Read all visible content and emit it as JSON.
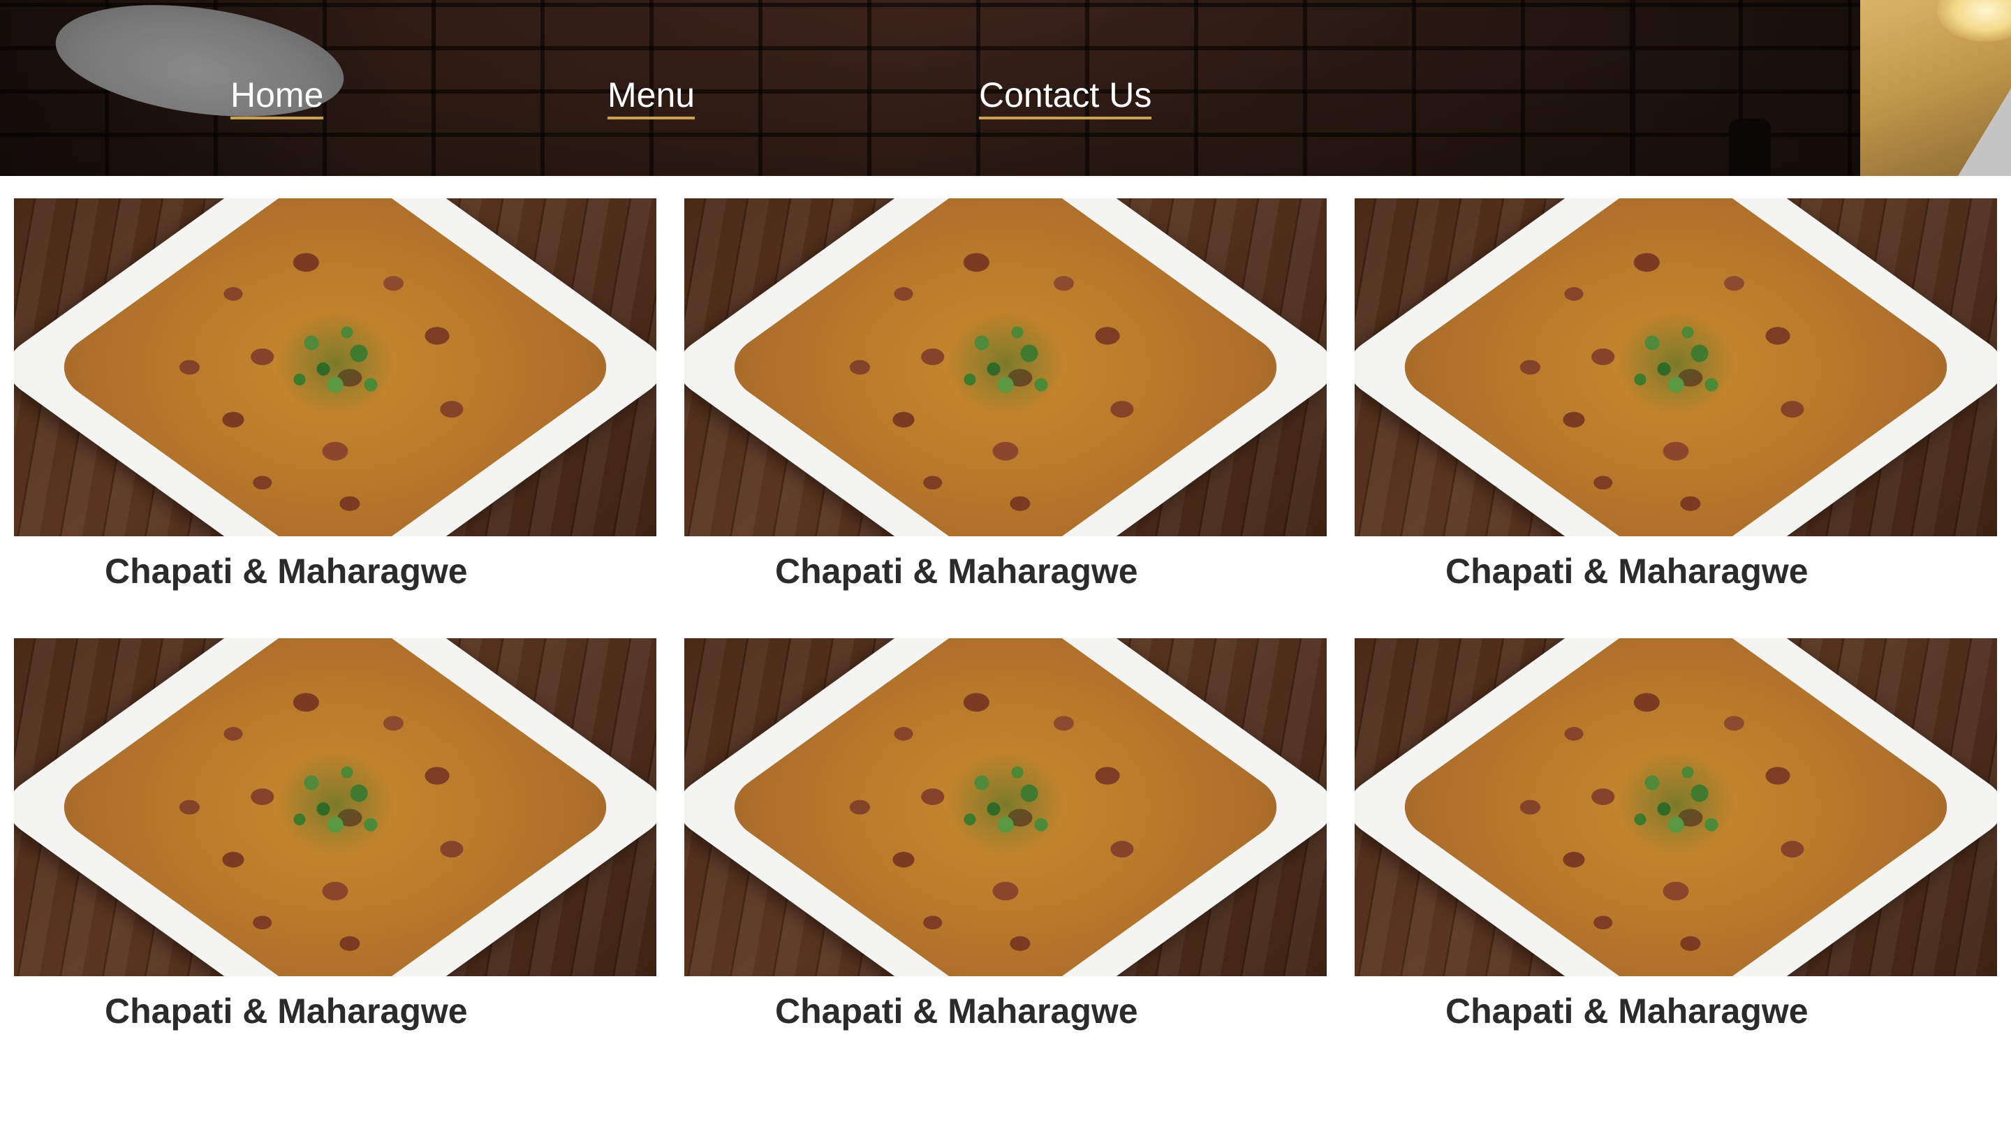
{
  "nav": {
    "items": [
      {
        "label": "Home"
      },
      {
        "label": "Menu"
      },
      {
        "label": "Contact Us"
      }
    ]
  },
  "menu": {
    "items": [
      {
        "title": "Chapati & Maharagwe"
      },
      {
        "title": "Chapati & Maharagwe"
      },
      {
        "title": "Chapati & Maharagwe"
      },
      {
        "title": "Chapati & Maharagwe"
      },
      {
        "title": "Chapati & Maharagwe"
      },
      {
        "title": "Chapati & Maharagwe"
      }
    ]
  },
  "colors": {
    "nav_underline": "#c9a24a",
    "title_text": "#2b2b2b",
    "nav_text": "#ffffff"
  }
}
